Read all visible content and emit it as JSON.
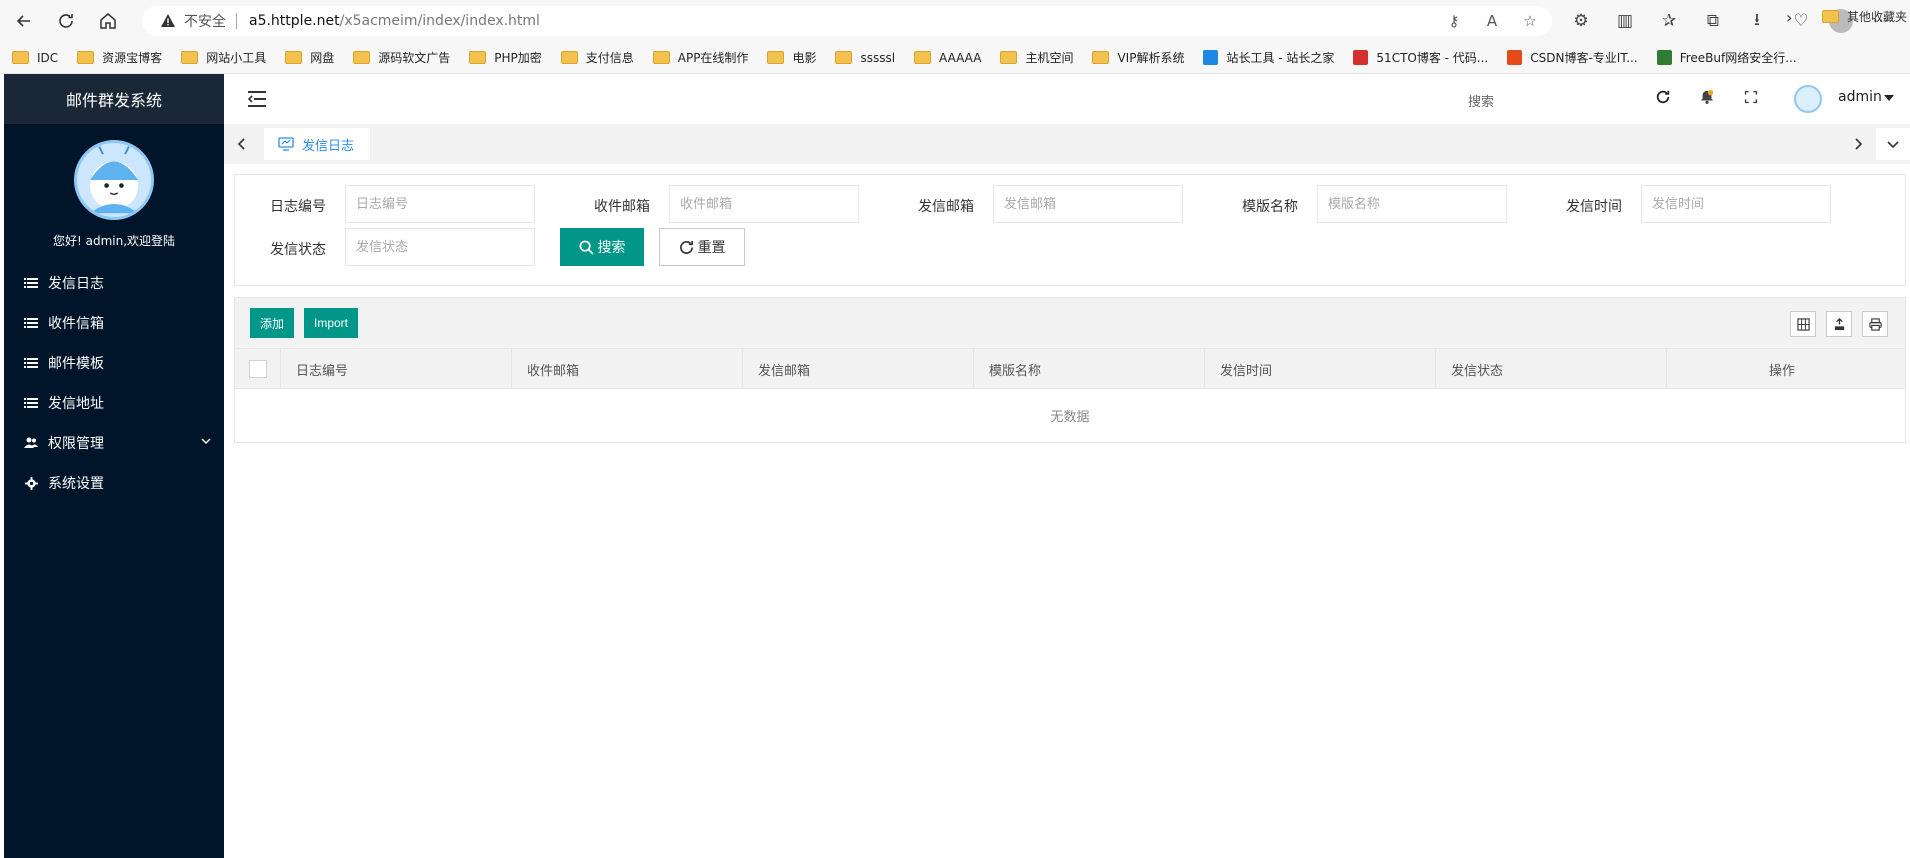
{
  "browser": {
    "insecure_label": "不安全",
    "url_host": "a5.httple.net",
    "url_path": "/x5acmeim/index/index.html",
    "bookmarks": [
      {
        "label": "IDC",
        "type": "folder"
      },
      {
        "label": "资源宝博客",
        "type": "folder"
      },
      {
        "label": "网站小工具",
        "type": "folder"
      },
      {
        "label": "网盘",
        "type": "folder"
      },
      {
        "label": "源码软文广告",
        "type": "folder"
      },
      {
        "label": "PHP加密",
        "type": "folder"
      },
      {
        "label": "支付信息",
        "type": "folder"
      },
      {
        "label": "APP在线制作",
        "type": "folder"
      },
      {
        "label": "电影",
        "type": "folder"
      },
      {
        "label": "sssssl",
        "type": "folder"
      },
      {
        "label": "AAAAA",
        "type": "folder"
      },
      {
        "label": "主机空间",
        "type": "folder"
      },
      {
        "label": "VIP解析系统",
        "type": "folder"
      },
      {
        "label": "站长工具 - 站长之家",
        "type": "site",
        "color": "#1e88e5"
      },
      {
        "label": "51CTO博客 - 代码...",
        "type": "site",
        "color": "#d32f2f"
      },
      {
        "label": "CSDN博客-专业IT...",
        "type": "site",
        "color": "#e64a19"
      },
      {
        "label": "FreeBuf网络安全行...",
        "type": "site",
        "color": "#2e7d32"
      }
    ],
    "other_bookmarks": "其他收藏夹"
  },
  "sidebar": {
    "title": "邮件群发系统",
    "welcome": "您好! admin,欢迎登陆",
    "items": [
      {
        "label": "发信日志",
        "icon": "list-icon"
      },
      {
        "label": "收件信箱",
        "icon": "list-icon"
      },
      {
        "label": "邮件模板",
        "icon": "list-icon"
      },
      {
        "label": "发信地址",
        "icon": "list-icon"
      },
      {
        "label": "权限管理",
        "icon": "users-icon"
      },
      {
        "label": "系统设置",
        "icon": "gear-icon"
      }
    ]
  },
  "header": {
    "search_label": "搜索",
    "username": "admin"
  },
  "tabs": {
    "active": "发信日志"
  },
  "search": {
    "fields": [
      {
        "label": "日志编号",
        "placeholder": "日志编号"
      },
      {
        "label": "收件邮箱",
        "placeholder": "收件邮箱"
      },
      {
        "label": "发信邮箱",
        "placeholder": "发信邮箱"
      },
      {
        "label": "模版名称",
        "placeholder": "模版名称"
      },
      {
        "label": "发信时间",
        "placeholder": "发信时间"
      },
      {
        "label": "发信状态",
        "placeholder": "发信状态"
      }
    ],
    "search_btn": "搜索",
    "reset_btn": "重置"
  },
  "table": {
    "add_btn": "添加",
    "import_btn": "Import",
    "columns": [
      "日志编号",
      "收件邮箱",
      "发信邮箱",
      "模版名称",
      "发信时间",
      "发信状态",
      "操作"
    ],
    "empty_text": "无数据"
  },
  "colors": {
    "primary": "#009688",
    "sidebar_bg": "#001529",
    "tab_active": "#2d8cf0"
  }
}
